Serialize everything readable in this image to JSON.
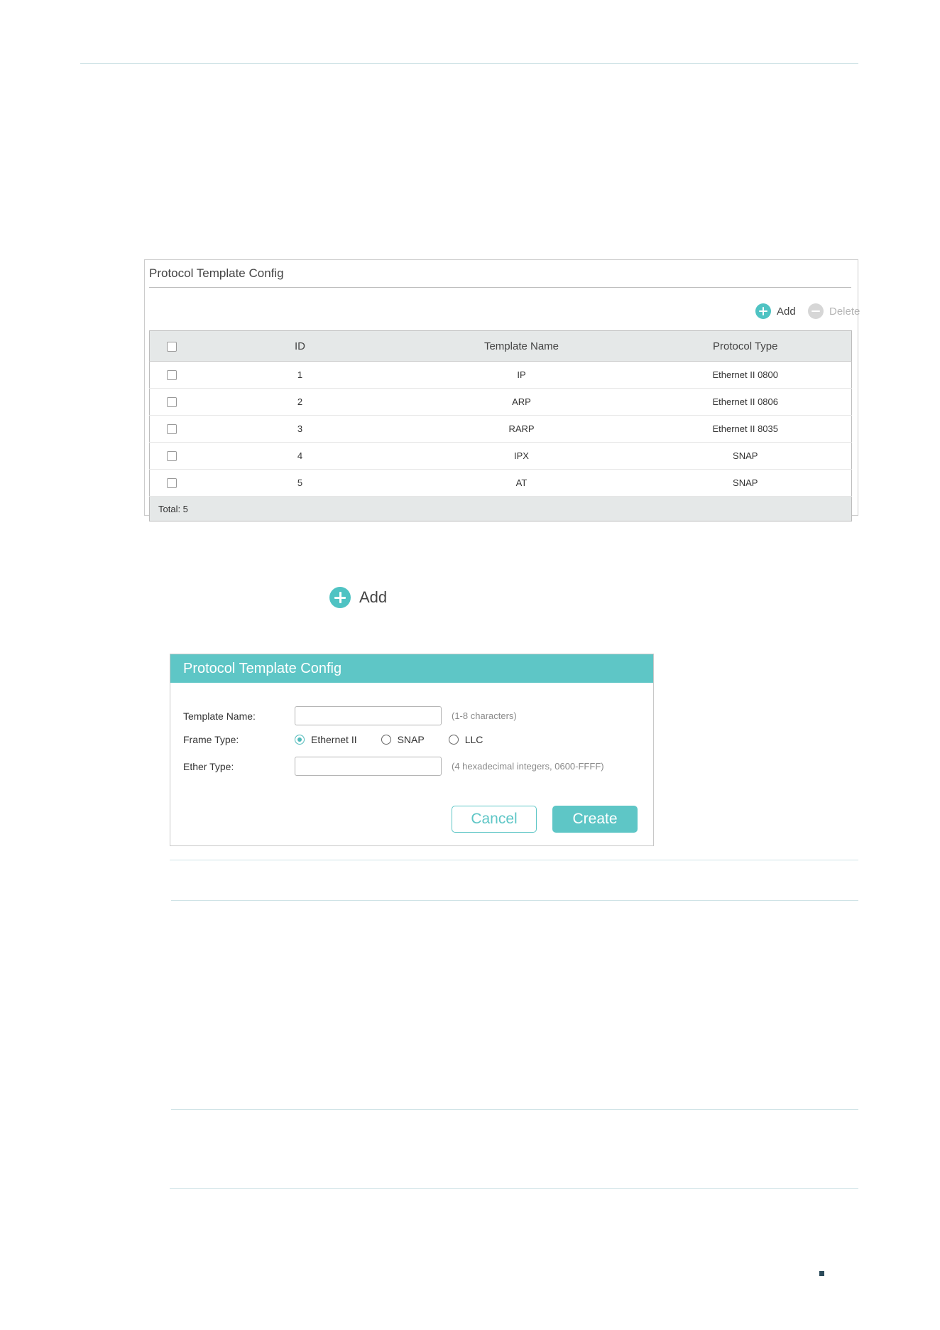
{
  "panel_table": {
    "title": "Protocol Template Config",
    "toolbar": {
      "add_label": "Add",
      "delete_label": "Delete"
    },
    "columns": [
      "ID",
      "Template Name",
      "Protocol Type"
    ],
    "rows": [
      {
        "id": "1",
        "template_name": "IP",
        "protocol_type": "Ethernet II 0800"
      },
      {
        "id": "2",
        "template_name": "ARP",
        "protocol_type": "Ethernet II 0806"
      },
      {
        "id": "3",
        "template_name": "RARP",
        "protocol_type": "Ethernet II 8035"
      },
      {
        "id": "4",
        "template_name": "IPX",
        "protocol_type": "SNAP"
      },
      {
        "id": "5",
        "template_name": "AT",
        "protocol_type": "SNAP"
      }
    ],
    "footer": "Total: 5"
  },
  "add_button_large": {
    "label": "Add"
  },
  "dialog": {
    "title": "Protocol Template Config",
    "template_name": {
      "label": "Template Name:",
      "value": "",
      "hint": "(1-8 characters)"
    },
    "frame_type": {
      "label": "Frame Type:",
      "options": [
        "Ethernet II",
        "SNAP",
        "LLC"
      ],
      "selected": "Ethernet II"
    },
    "ether_type": {
      "label": "Ether Type:",
      "value": "",
      "hint": "(4 hexadecimal integers, 0600-FFFF)"
    },
    "cancel_label": "Cancel",
    "create_label": "Create"
  },
  "colors": {
    "accent": "#5ec6c6",
    "header_bg": "#e5e8e8",
    "rule": "#cfe3e6"
  }
}
